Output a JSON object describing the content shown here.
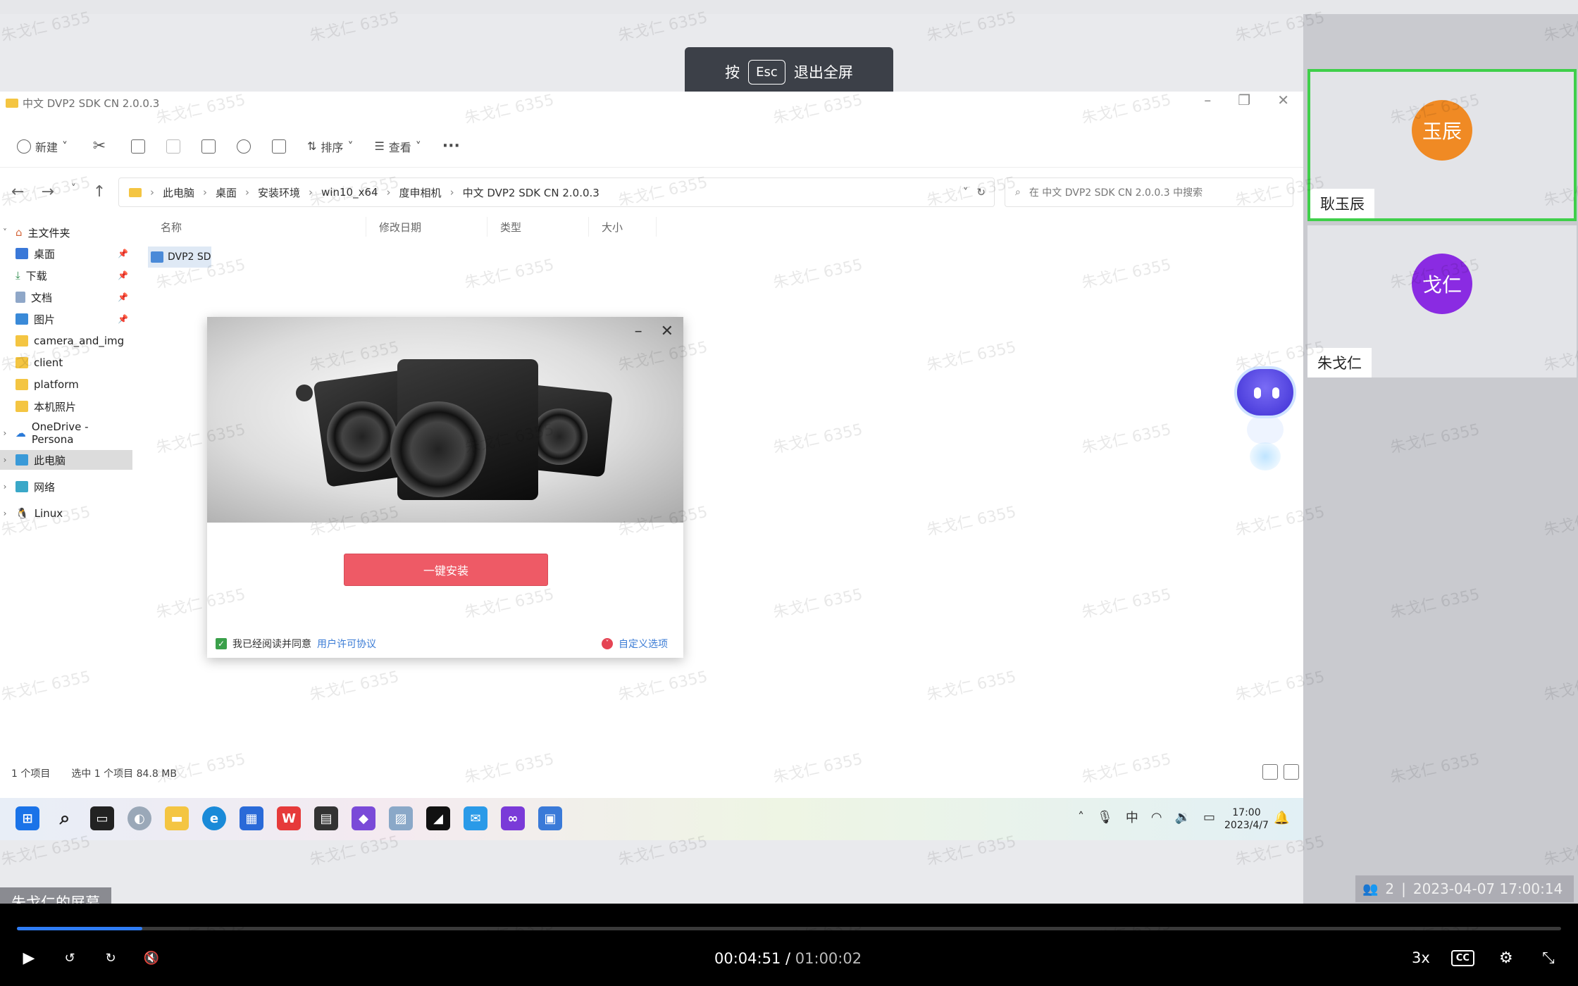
{
  "window": {
    "esc_prefix": "按",
    "esc_key": "Esc",
    "esc_suffix": "退出全屏",
    "explorer_title": "中文 DVP2 SDK CN 2.0.0.3"
  },
  "explorer": {
    "ribbon": {
      "new": "新建",
      "sort": "排序",
      "view": "查看",
      "more": "···"
    },
    "breadcrumbs": [
      "此电脑",
      "桌面",
      "安装环境",
      "win10_x64",
      "度申相机",
      "中文 DVP2 SDK CN 2.0.0.3"
    ],
    "search_placeholder": "在 中文 DVP2 SDK CN 2.0.0.3 中搜索",
    "sidebar": {
      "home": "主文件夹",
      "desktop": "桌面",
      "downloads": "下载",
      "documents": "文档",
      "pictures": "图片",
      "camera_and_img": "camera_and_img",
      "client": "client",
      "platform": "platform",
      "local_photos": "本机照片",
      "onedrive": "OneDrive - Persona",
      "this_pc": "此电脑",
      "network": "网络",
      "linux": "Linux"
    },
    "columns": {
      "name": "名称",
      "modified": "修改日期",
      "type": "类型",
      "size": "大小"
    },
    "file_name": "DVP2 SD",
    "status": {
      "count": "1 个项目",
      "selected": "选中 1 个项目  84.8 MB"
    }
  },
  "installer": {
    "install_label": "一键安装",
    "agree_text": "我已经阅读并同意",
    "license_link": "用户许可协议",
    "custom_options": "自定义选项"
  },
  "taskbar": {
    "clock_time": "17:00",
    "clock_date": "2023/4/7",
    "ime": "中"
  },
  "screen_label": "朱戈仁的屏幕",
  "participants": [
    {
      "avatar": "玉辰",
      "name": "耿玉辰",
      "color": "#f08a24"
    },
    {
      "avatar": "戈仁",
      "name": "朱戈仁",
      "color": "#8a2be2"
    }
  ],
  "meeting": {
    "count": "2",
    "timestamp": "2023-04-07 17:00:14"
  },
  "player": {
    "current_time": "00:04:51",
    "separator": " / ",
    "total_time": "01:00:02",
    "progress_fraction": 0.081,
    "speed": "3x",
    "cc_label": "CC"
  },
  "watermark_text": "朱戈仁 6355"
}
